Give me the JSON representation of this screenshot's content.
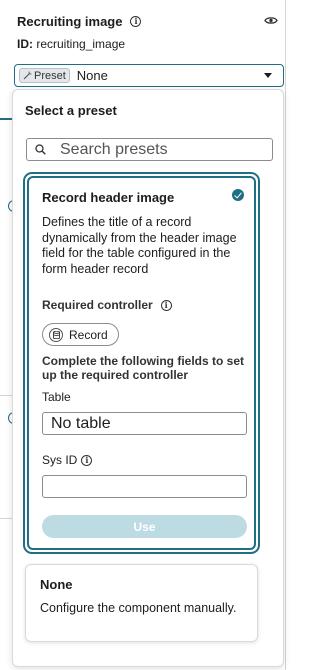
{
  "field": {
    "label": "Recruiting image",
    "id_prefix": "ID:",
    "id_value": "recruiting_image"
  },
  "preset_select": {
    "chip_label": "Preset",
    "value": "None"
  },
  "popover": {
    "title": "Select a preset",
    "search_placeholder": "Search presets",
    "presets": [
      {
        "title": "Record header image",
        "description": "Defines the title of a record dynamically from the header image field for the table configured in the form header record",
        "selected": true,
        "required_controller_label": "Required controller",
        "controller_name": "Record",
        "complete_fields_text": "Complete the following fields to set up the required controller",
        "table_label": "Table",
        "table_value": "No table",
        "sysid_label": "Sys ID",
        "sysid_value": "",
        "use_button_label": "Use"
      },
      {
        "title": "None",
        "description": "Configure the component manually.",
        "selected": false
      }
    ]
  },
  "colors": {
    "accent": "#1f6f84",
    "button_disabled": "#bcdbe2",
    "border": "#8c8c8c"
  },
  "icons": [
    "info-icon",
    "eye-icon",
    "wand-icon",
    "chevron-down-icon",
    "search-icon",
    "check-circle-icon",
    "database-icon"
  ]
}
